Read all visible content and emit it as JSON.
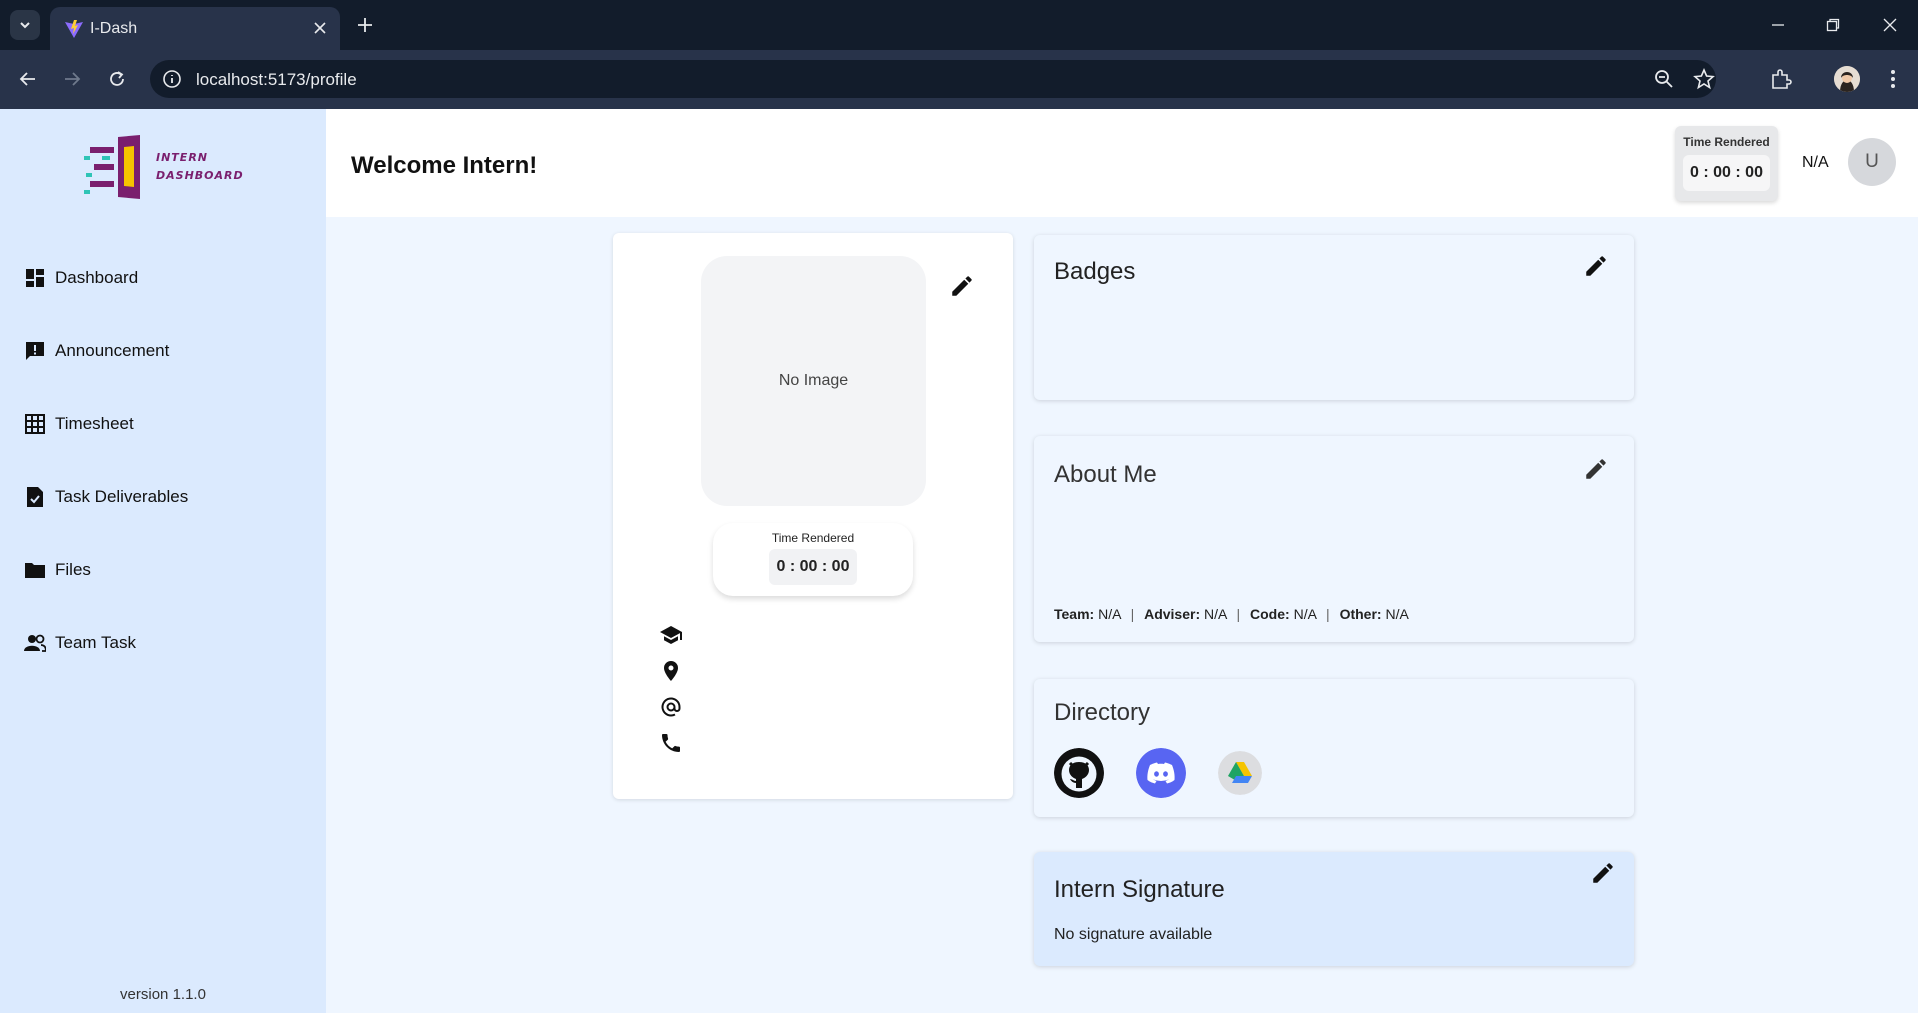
{
  "browser": {
    "tab_title": "I-Dash",
    "url": "localhost:5173/profile",
    "icons": [
      "tab-search-icon",
      "vite-favicon-icon",
      "close-icon",
      "plus-icon",
      "minimize-icon",
      "restore-icon",
      "window-close-icon",
      "back-icon",
      "forward-icon",
      "reload-icon",
      "site-info-icon",
      "zoom-icon",
      "star-icon",
      "extensions-icon",
      "more-icon"
    ]
  },
  "sidebar": {
    "logo_line1": "INTERN",
    "logo_line2": "DASHBOARD",
    "items": [
      {
        "label": "Dashboard",
        "icon": "dashboard-icon"
      },
      {
        "label": "Announcement",
        "icon": "announcement-icon"
      },
      {
        "label": "Timesheet",
        "icon": "grid-icon"
      },
      {
        "label": "Task Deliverables",
        "icon": "task-icon"
      },
      {
        "label": "Files",
        "icon": "folder-icon"
      },
      {
        "label": "Team Task",
        "icon": "team-icon"
      }
    ],
    "version": "version 1.1.0"
  },
  "header": {
    "welcome": "Welcome Intern!",
    "time_rendered_label": "Time Rendered",
    "time_rendered_value": "0 : 00 : 00",
    "user_name": "N/A",
    "avatar_initial": "U"
  },
  "profile": {
    "no_image": "No Image",
    "time_rendered_label": "Time Rendered",
    "time_rendered_value": "0 : 00 : 00",
    "info_icons": [
      "graduation-cap-icon",
      "location-pin-icon",
      "at-sign-icon",
      "phone-icon"
    ]
  },
  "badges": {
    "title": "Badges"
  },
  "about": {
    "title": "About Me",
    "team_label": "Team:",
    "team_value": "N/A",
    "adviser_label": "Adviser:",
    "adviser_value": "N/A",
    "code_label": "Code:",
    "code_value": "N/A",
    "other_label": "Other:",
    "other_value": "N/A",
    "separator": "|"
  },
  "directory": {
    "title": "Directory",
    "links": [
      "github-icon",
      "discord-icon",
      "google-drive-icon"
    ]
  },
  "signature": {
    "title": "Intern Signature",
    "text": "No signature available"
  },
  "colors": {
    "sidebar_bg": "#dbeafe",
    "main_bg": "#eff6ff",
    "discord": "#5865f2",
    "logo_purple": "#7a1f6e",
    "logo_teal": "#2ec4b6",
    "logo_yellow": "#f5c400"
  }
}
